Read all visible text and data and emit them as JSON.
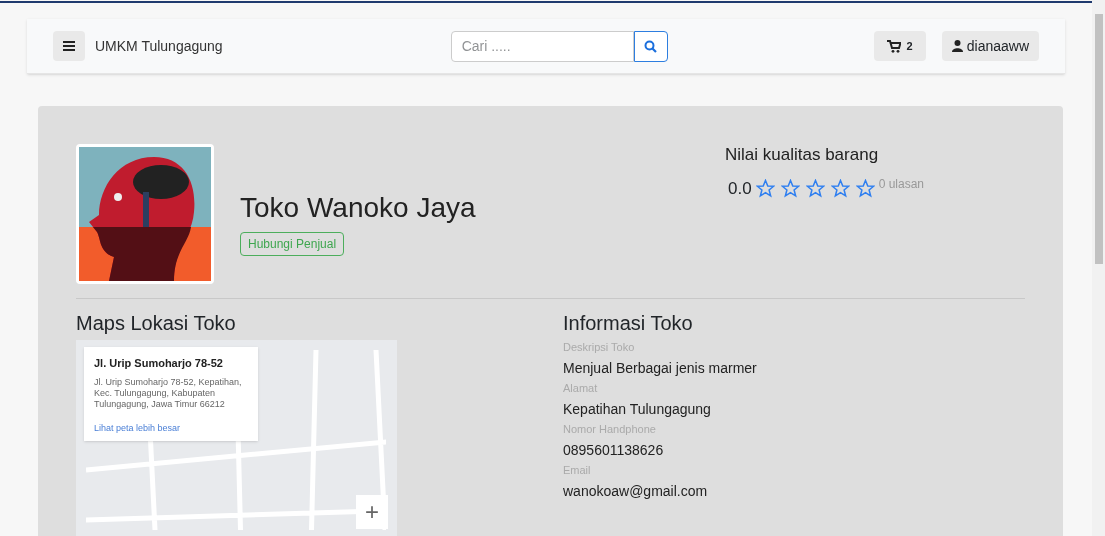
{
  "navbar": {
    "brand": "UMKM Tulungagung",
    "search": {
      "placeholder": "Cari ....."
    },
    "cart_count": "2",
    "user": "dianaaww"
  },
  "store": {
    "name": "Toko Wanoko Jaya",
    "contact_button": "Hubungi Penjual"
  },
  "rating": {
    "title": "Nilai kualitas barang",
    "score": "0.0",
    "stars": 0,
    "reviews": "0 ulasan"
  },
  "map": {
    "title": "Maps Lokasi Toko",
    "popup": {
      "title": "Jl. Urip Sumoharjo 78-52",
      "address": "Jl. Urip Sumoharjo 78-52, Kepatihan, Kec. Tulungagung, Kabupaten Tulungagung, Jawa Timur 66212",
      "link": "Lihat peta lebih besar"
    },
    "zoom_in": "+"
  },
  "info": {
    "title": "Informasi Toko",
    "fields": [
      {
        "label": "Deskripsi Toko",
        "value": "Menjual Berbagai jenis marmer"
      },
      {
        "label": "Alamat",
        "value": "Kepatihan Tulungagung"
      },
      {
        "label": "Nomor Handphone",
        "value": "0895601138626"
      },
      {
        "label": "Email",
        "value": "wanokoaw@gmail.com"
      }
    ]
  }
}
